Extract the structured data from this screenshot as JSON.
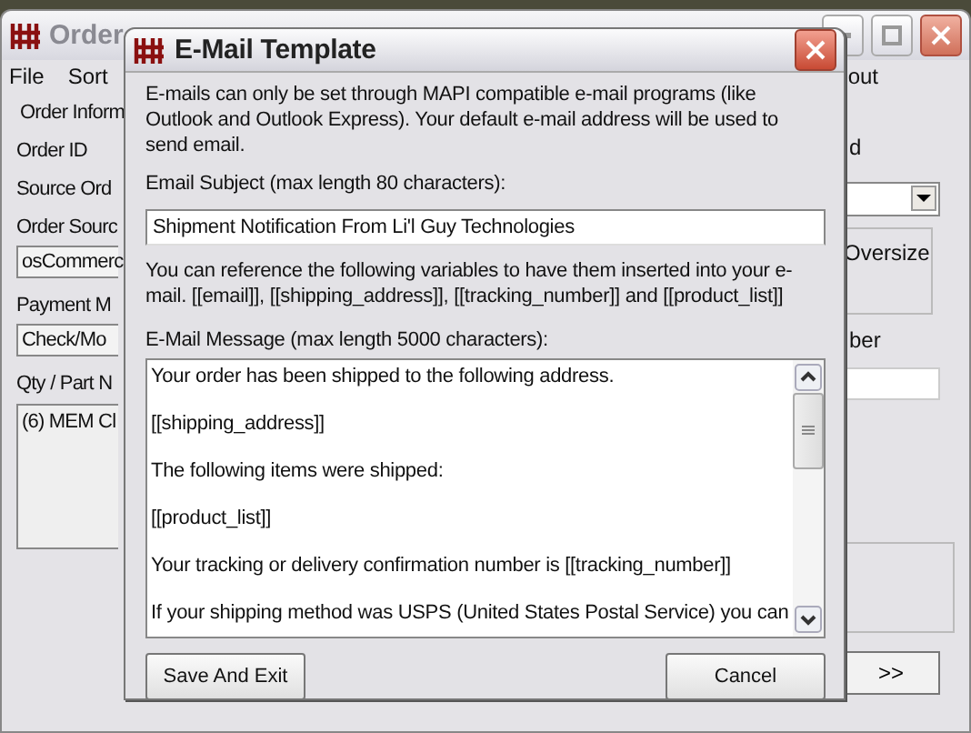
{
  "background_window": {
    "title": "Order",
    "menu": [
      "File",
      "Sort",
      "out"
    ],
    "left": [
      {
        "kind": "group",
        "text": "Order Inform"
      },
      {
        "kind": "label",
        "text": "Order ID"
      },
      {
        "kind": "label",
        "text": "Source Ord"
      },
      {
        "kind": "label",
        "text": "Order Sourc"
      },
      {
        "kind": "field",
        "text": "osCommerc"
      },
      {
        "kind": "label",
        "text": "Payment M"
      },
      {
        "kind": "field",
        "text": "Check/Mo"
      },
      {
        "kind": "label",
        "text": "Qty / Part N"
      },
      {
        "kind": "list",
        "text": "(6) MEM Cl"
      }
    ],
    "right": [
      {
        "kind": "label",
        "text": "d"
      },
      {
        "kind": "combo"
      },
      {
        "kind": "group",
        "text": "Oversize"
      },
      {
        "kind": "label",
        "text": "ber"
      },
      {
        "kind": "field"
      },
      {
        "kind": "panel"
      }
    ],
    "next_button": ">>"
  },
  "dialog": {
    "title": "E-Mail Template",
    "intro": "E-mails can only be set through MAPI compatible e-mail programs (like Outlook and Outlook Express). Your default e-mail address will be used to send email.",
    "subject_label": "Email Subject (max length 80 characters):",
    "subject_value": "Shipment Notification From Li'l Guy Technologies",
    "variables_note": "You can reference the following variables to have them inserted into your e-mail. [[email]], [[shipping_address]], [[tracking_number]] and [[product_list]]",
    "message_label": "E-Mail Message (max length 5000 characters):",
    "message_lines": [
      "Your order has been shipped to the following address.",
      "[[shipping_address]]",
      "The following items were shipped:",
      "[[product_list]]",
      "Your tracking or delivery confirmation number is [[tracking_number]]",
      "If your shipping method was USPS (United States Postal Service) you can"
    ],
    "buttons": [
      "Save And Exit",
      "Cancel"
    ]
  }
}
